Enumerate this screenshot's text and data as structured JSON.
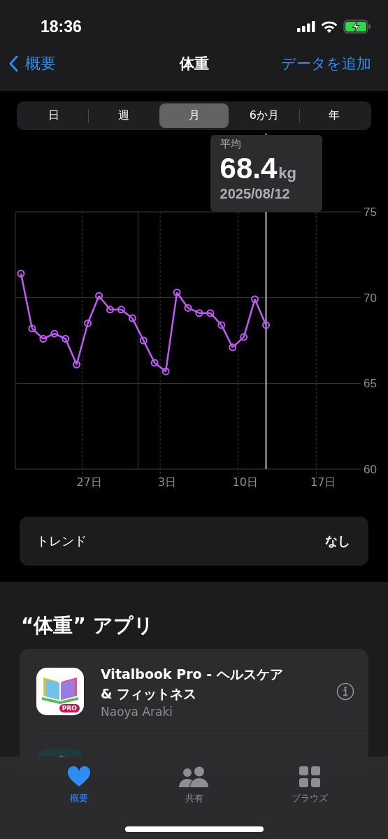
{
  "status_bar": {
    "time": "18:36"
  },
  "nav": {
    "back": "概要",
    "title": "体重",
    "action": "データを追加"
  },
  "segments": [
    {
      "label": "日",
      "selected": false
    },
    {
      "label": "週",
      "selected": false
    },
    {
      "label": "月",
      "selected": true
    },
    {
      "label": "6か月",
      "selected": false
    },
    {
      "label": "年",
      "selected": false
    }
  ],
  "tooltip": {
    "label": "平均",
    "value": "68.4",
    "unit": "kg",
    "date": "2025/08/12"
  },
  "chart": {
    "chart_data": {
      "type": "line",
      "categories": [
        null,
        null,
        null,
        null,
        null,
        null,
        "27日",
        null,
        null,
        null,
        null,
        null,
        null,
        "3日",
        null,
        null,
        null,
        null,
        null,
        null,
        "10日",
        null,
        null,
        null,
        null,
        null,
        null,
        "17日",
        null,
        null,
        null
      ],
      "series": [
        {
          "color": "#bf5af2",
          "marker": "circle",
          "values": [
            71.4,
            68.2,
            67.6,
            67.9,
            67.6,
            66.1,
            68.5,
            70.1,
            69.3,
            69.3,
            68.8,
            67.5,
            66.2,
            65.7,
            70.3,
            69.4,
            69.1,
            69.1,
            68.4,
            67.1,
            67.7,
            69.9,
            68.4,
            null,
            null,
            null,
            null,
            null,
            null,
            null,
            null
          ]
        }
      ],
      "ylim": [
        60,
        75
      ],
      "yticks": [
        60,
        65,
        70,
        75
      ]
    }
  },
  "trend": {
    "label": "トレンド",
    "value": "なし"
  },
  "apps_section": {
    "title": "“体重” アプリ",
    "apps": [
      {
        "kind": "full",
        "name": "Vitalbook Pro - ヘルスケア & フィットネス",
        "developer": "Naoya Araki",
        "badge": "PRO"
      },
      {
        "kind": "covered"
      }
    ]
  },
  "tab_bar": [
    {
      "label": "概要",
      "selected": true
    },
    {
      "label": "共有",
      "selected": false
    },
    {
      "label": "ブラウズ",
      "selected": false
    }
  ]
}
